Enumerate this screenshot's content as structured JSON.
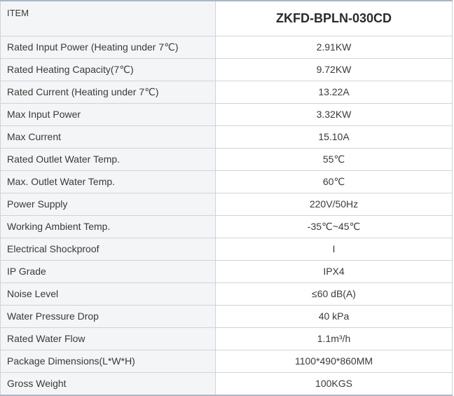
{
  "table": {
    "header": {
      "label": "ITEM",
      "model": "ZKFD-BPLN-030CD"
    },
    "rows": [
      {
        "label": "Rated Input Power  (Heating under 7℃)",
        "value": "2.91KW"
      },
      {
        "label": "Rated Heating Capacity(7℃)",
        "value": "9.72KW"
      },
      {
        "label": "Rated Current  (Heating under 7℃)",
        "value": "13.22A"
      },
      {
        "label": "Max Input Power",
        "value": "3.32KW"
      },
      {
        "label": "Max Current",
        "value": "15.10A"
      },
      {
        "label": "Rated Outlet Water Temp.",
        "value": "55℃"
      },
      {
        "label": "Max. Outlet Water Temp.",
        "value": "60℃"
      },
      {
        "label": "Power Supply",
        "value": "220V/50Hz"
      },
      {
        "label": "Working Ambient Temp.",
        "value": "-35℃~45℃"
      },
      {
        "label": "Electrical Shockproof",
        "value": "I"
      },
      {
        "label": "IP Grade",
        "value": "IPX4"
      },
      {
        "label": "Noise Level",
        "value": "≤60 dB(A)"
      },
      {
        "label": "Water Pressure Drop",
        "value": "40 kPa"
      },
      {
        "label": "Rated Water Flow",
        "value": "1.1m³/h"
      },
      {
        "label": "Package Dimensions(L*W*H)",
        "value": "1100*490*860MM"
      },
      {
        "label": "Gross Weight",
        "value": "100KGS"
      }
    ]
  }
}
